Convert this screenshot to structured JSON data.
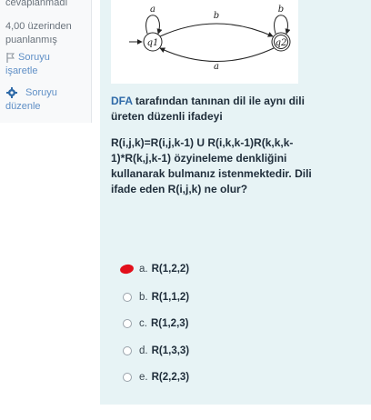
{
  "sidebar": {
    "status": "cevaplanmadı",
    "score_line1": "4,00 üzerinden",
    "score_line2": "puanlanmış",
    "flag_line1": "Soruyu",
    "flag_line2": "işaretle",
    "edit_line1": "Soruyu",
    "edit_line2": "düzenle"
  },
  "diagram": {
    "state1": "q1",
    "state2": "q2",
    "loop1_label": "a",
    "loop2_label": "b",
    "top_edge_label": "b",
    "bottom_edge_label": "a"
  },
  "question": {
    "line1_prefix": "DFA",
    "line1_rest": " tarafından tanınan dil ile aynı dili üreten düzenli ifadeyi",
    "line2": "R(i,j,k)=R(i,j,k-1) U R(i,k,k-1)R(k,k,k-1)*R(k,j,k-1) özyineleme denkliğini kullanarak bulmanız istenmektedir. Dili ifade eden R(i,j,k) ne olur?"
  },
  "options": [
    {
      "letter": "a.",
      "value": "R(1,2,2)",
      "marked": true
    },
    {
      "letter": "b.",
      "value": "R(1,1,2)",
      "marked": false
    },
    {
      "letter": "c.",
      "value": "R(1,2,3)",
      "marked": false
    },
    {
      "letter": "d.",
      "value": "R(1,3,3)",
      "marked": false
    },
    {
      "letter": "e.",
      "value": "R(2,2,3)",
      "marked": false
    }
  ],
  "colors": {
    "accent": "#2f6aa8",
    "panel": "#e7f3f5",
    "mark": "#e20f1b"
  }
}
